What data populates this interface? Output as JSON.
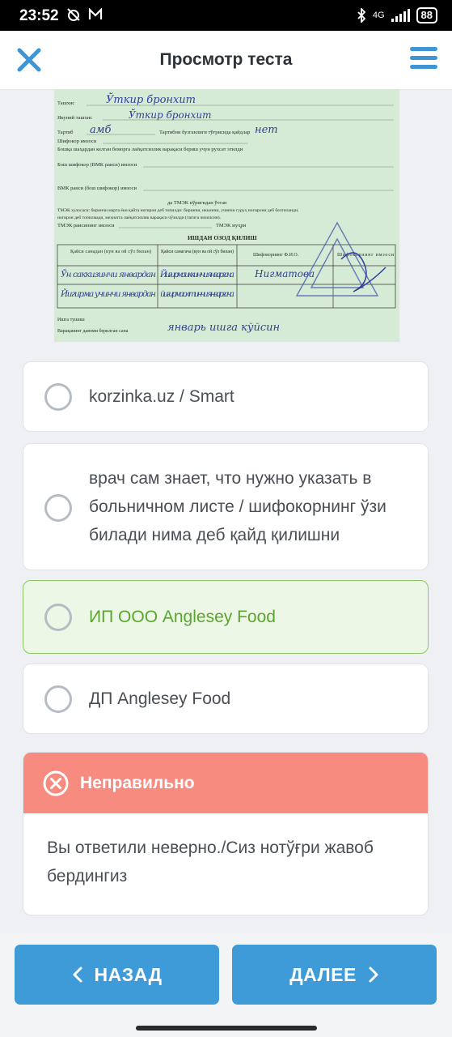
{
  "status_bar": {
    "time": "23:52",
    "network": "4G",
    "battery": "88"
  },
  "header": {
    "title": "Просмотр теста",
    "close_icon": "close-icon",
    "menu_icon": "hamburger-menu-icon"
  },
  "question_image": {
    "texts": {
      "line1": "Ташхис",
      "line2": "Якуний ташхис",
      "line3": "Тартиб",
      "line3b": "Тартибни бузганлиги тўғрисида қайдлар",
      "line4": "Шифокор имзоси",
      "line5": "Бошқа шаҳардан келган беморга лаёқатсизлик варақаси бериш учун рухсат этилди",
      "line6": "Бош шифокор (ВМК раиси) имзоси",
      "line7": "ВМК раиси (бош шифокор) имзоси",
      "line8": "да ТМЭК кўригидан ўтган",
      "line9": "ТМЭК хулосаси: биринчи марта ёки қайта ногирон деб топилди: биринчи, иккинчи, учинчи гуруҳ ногирони деб белгиланди;",
      "line10": "ногирон деб топилмади, меҳнатга лаёқатсизлик варақаси чўзилди (тагига чизилсин).",
      "line11": "ТМЭК раисининг имзоси",
      "line11b": "ТМЭК муҳри",
      "table_title": "ИШДАН ОЗОД ҚИЛИШ",
      "col1": "Қайси санадан (кун ва ой сўз билан)",
      "col2": "Қайси санагача (кун ва ой сўз билан)",
      "col3": "Шифокорнинг Ф.И.О.",
      "col4": "Шифокорнинг имзоси",
      "line12": "Варақанинг давоми берилган сана",
      "line13": "Ишга тушиш",
      "line14": "йил",
      "hand1": "Ўткир бронхит",
      "hand2": "Ўткир бронхит",
      "hand3": "амб",
      "hand4": "нет",
      "hand5": "Ўн саккизинчи январдан",
      "hand6": "Йигирма иккин-чи январгача",
      "hand7": "Нигматова",
      "hand8": "Йигирма учинчи январдан",
      "hand9": "йигирма олтинчи январгача",
      "hand10": "январь ишга кўйсин"
    }
  },
  "options": [
    {
      "label": "korzinka.uz / Smart",
      "selected": false
    },
    {
      "label": "врач сам знает, что нужно указать в больничном листе / шифокорнинг ўзи билади нима деб қайд қилишни",
      "selected": false
    },
    {
      "label": "ИП ООО Anglesey Food",
      "selected": true
    },
    {
      "label": "ДП Anglesey Food",
      "selected": false
    }
  ],
  "result": {
    "title": "Неправильно",
    "message": "Вы ответили неверно./Сиз нотўғри жавоб бердингиз",
    "status_color": "#f78b80"
  },
  "navigation": {
    "back_label": "НАЗАД",
    "next_label": "ДАЛЕЕ"
  },
  "colors": {
    "accent": "#3f9ad8",
    "selected_green": "#5aa52f",
    "error": "#f78b80"
  }
}
